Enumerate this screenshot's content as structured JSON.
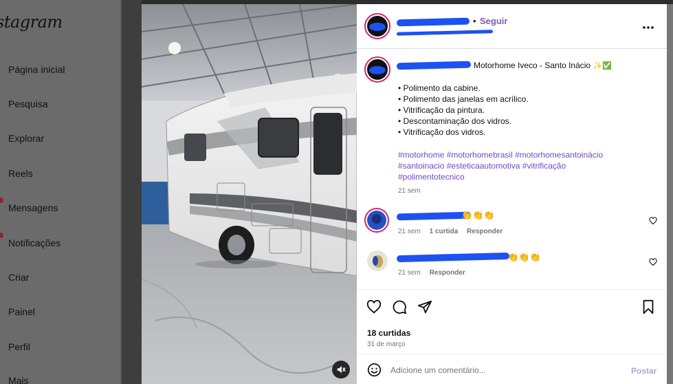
{
  "sidebar": {
    "logo": "stagram",
    "items": [
      {
        "label": "Página inicial"
      },
      {
        "label": "Pesquisa"
      },
      {
        "label": "Explorar"
      },
      {
        "label": "Reels"
      },
      {
        "label": "Mensagens"
      },
      {
        "label": "Notificações"
      },
      {
        "label": "Criar"
      },
      {
        "label": "Painel"
      },
      {
        "label": "Perfil"
      },
      {
        "label": "Mais"
      }
    ]
  },
  "post": {
    "header": {
      "separator": "•",
      "follow_label": "Seguir"
    },
    "caption": {
      "title": "Motorhome Iveco - Santo Inácio",
      "title_emojis": "✨✅",
      "bullets": [
        "• Polimento da cabine.",
        "• Polimento das janelas em acrílico.",
        "• Vitrificação da pintura.",
        "• Descontaminação dos vidros.",
        "• Vitrificação dos vidros."
      ],
      "hashtags_line1": "#motorhome #motorhomebrasil #motorhomesantoinácio",
      "hashtags_line2": "#santoinacio #esteticaautomotiva #vitrificação",
      "hashtags_line3": "#polimentotecnico",
      "time": "21 sem"
    },
    "comments": [
      {
        "emoji": "👏👏👏",
        "time": "21 sem",
        "likes": "1 curtida",
        "reply": "Responder"
      },
      {
        "emoji": "👏👏👏",
        "time": "21 sem",
        "reply": "Responder"
      }
    ],
    "likes": "18 curtidas",
    "date": "31 de março",
    "comment_placeholder": "Adicione um comentário...",
    "post_button": "Postar"
  },
  "colors": {
    "accent": "#7e5bb2",
    "hashtag": "#6d4bc3",
    "redaction": "#1d52f0",
    "story_ring": "#d3246f"
  },
  "icons": {
    "more": "more-options-icon",
    "like": "heart-icon",
    "comment": "comment-bubble-icon",
    "share": "paper-plane-icon",
    "save": "bookmark-icon",
    "emoji": "smiley-icon",
    "mute": "speaker-muted-icon"
  }
}
